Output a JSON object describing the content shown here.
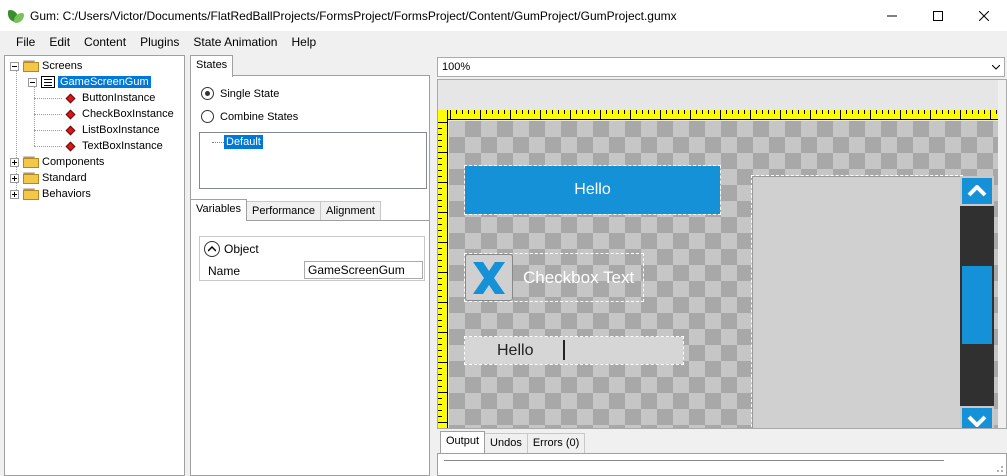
{
  "window": {
    "title": "Gum: C:/Users/Victor/Documents/FlatRedBallProjects/FormsProject/FormsProject/Content/GumProject/GumProject.gumx",
    "minimize": "—",
    "maximize": "☐",
    "close": "✕"
  },
  "menu": [
    "File",
    "Edit",
    "Content",
    "Plugins",
    "State Animation",
    "Help"
  ],
  "tree": {
    "screens": "Screens",
    "game_screen": "GameScreenGum",
    "instances": [
      "ButtonInstance",
      "CheckBoxInstance",
      "ListBoxInstance",
      "TextBoxInstance"
    ],
    "components": "Components",
    "standard": "Standard",
    "behaviors": "Behaviors"
  },
  "states": {
    "tab": "States",
    "single_state": "Single State",
    "combine_states": "Combine States",
    "list": [
      "Default"
    ]
  },
  "variables": {
    "tabs": [
      "Variables",
      "Performance",
      "Alignment"
    ],
    "category": "Object",
    "name_label": "Name",
    "name_value": "GameScreenGum"
  },
  "canvas": {
    "zoom": "100%",
    "button_text": "Hello",
    "checkbox_text": "Checkbox Text",
    "textbox_text": "Hello"
  },
  "output": {
    "tabs": [
      "Output",
      "Undos",
      "Errors (0)"
    ]
  },
  "colors": {
    "accent": "#0078d7",
    "gum_blue": "#1591d8",
    "ruler": "#ffff00"
  }
}
